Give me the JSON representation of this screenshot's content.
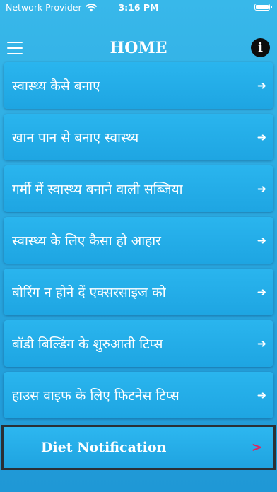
{
  "status_bar": {
    "carrier": "Network Provider",
    "time": "3:16 PM",
    "wifi_icon": "wifi-icon",
    "battery_icon": "battery-icon"
  },
  "header": {
    "title": "HOME",
    "menu_icon": "hamburger-menu-icon",
    "info_icon": "info-icon",
    "info_glyph": "i"
  },
  "menu": {
    "items": [
      {
        "label": "स्वास्थ्य कैसे बनाए",
        "arrow": "➜"
      },
      {
        "label": "खान पान से बनाए स्वास्थ्य",
        "arrow": "➜"
      },
      {
        "label": "गर्मी में स्वास्थ्य बनाने वाली सब्जिया",
        "arrow": "➜"
      },
      {
        "label": "स्वास्थ्य के लिए कैसा हो आहार",
        "arrow": "➜"
      },
      {
        "label": "बोरिंग न होने दें एक्सरसाइज को",
        "arrow": "➜"
      },
      {
        "label": "बॉडी बिल्डिंग के शुरुआती टिप्स",
        "arrow": "➜"
      },
      {
        "label": "हाउस वाइफ के लिए फिटनेस टिप्स",
        "arrow": "➜"
      }
    ]
  },
  "diet_notification": {
    "label": "Diet Notification",
    "chevron": ">",
    "chevron_color": "#e0245e"
  },
  "colors": {
    "background": "#2aa6de",
    "item_background": "#24aee8",
    "text": "#ffffff"
  }
}
